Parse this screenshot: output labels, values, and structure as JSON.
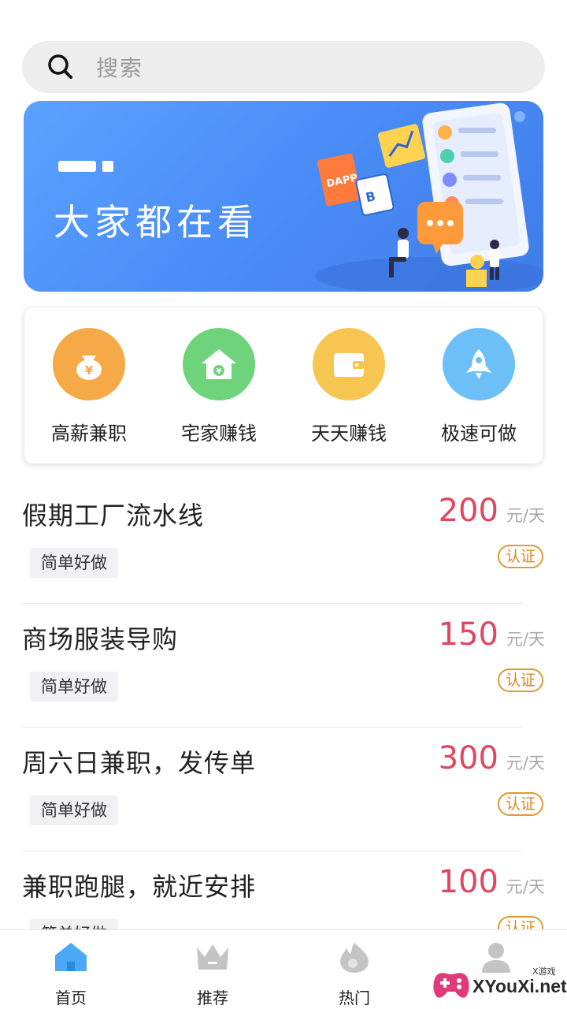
{
  "search": {
    "placeholder": "搜索"
  },
  "banner": {
    "title": "大家都在看",
    "art_labels": [
      "DAPP",
      "B"
    ]
  },
  "categories": [
    {
      "label": "高薪兼职",
      "icon": "money-bag-icon",
      "color": "#f6a947"
    },
    {
      "label": "宅家赚钱",
      "icon": "house-icon",
      "color": "#6ed37b"
    },
    {
      "label": "天天赚钱",
      "icon": "wallet-icon",
      "color": "#f7c552"
    },
    {
      "label": "极速可做",
      "icon": "rocket-icon",
      "color": "#6cc0f7"
    }
  ],
  "jobs": [
    {
      "title": "假期工厂流水线",
      "tag": "简单好做",
      "price": "200",
      "unit": "元/天",
      "badge": "认证"
    },
    {
      "title": "商场服装导购",
      "tag": "简单好做",
      "price": "150",
      "unit": "元/天",
      "badge": "认证"
    },
    {
      "title": "周六日兼职，发传单",
      "tag": "简单好做",
      "price": "300",
      "unit": "元/天",
      "badge": "认证"
    },
    {
      "title": "兼职跑腿，就近安排",
      "tag": "简单好做",
      "price": "100",
      "unit": "元/天",
      "badge": "认证"
    }
  ],
  "nav": [
    {
      "label": "首页",
      "icon": "home-icon",
      "active": true
    },
    {
      "label": "推荐",
      "icon": "crown-icon",
      "active": false
    },
    {
      "label": "热门",
      "icon": "flame-icon",
      "active": false
    },
    {
      "label": "",
      "icon": "profile-icon",
      "active": false
    }
  ],
  "watermark": {
    "text": "XYouXi.net",
    "small": "X游戏"
  },
  "colors": {
    "accent": "#4b8ef7",
    "price": "#e0465f",
    "badge": "#e09a33",
    "active_nav": "#4aa8f5",
    "inactive_nav": "#c4c4c4"
  }
}
